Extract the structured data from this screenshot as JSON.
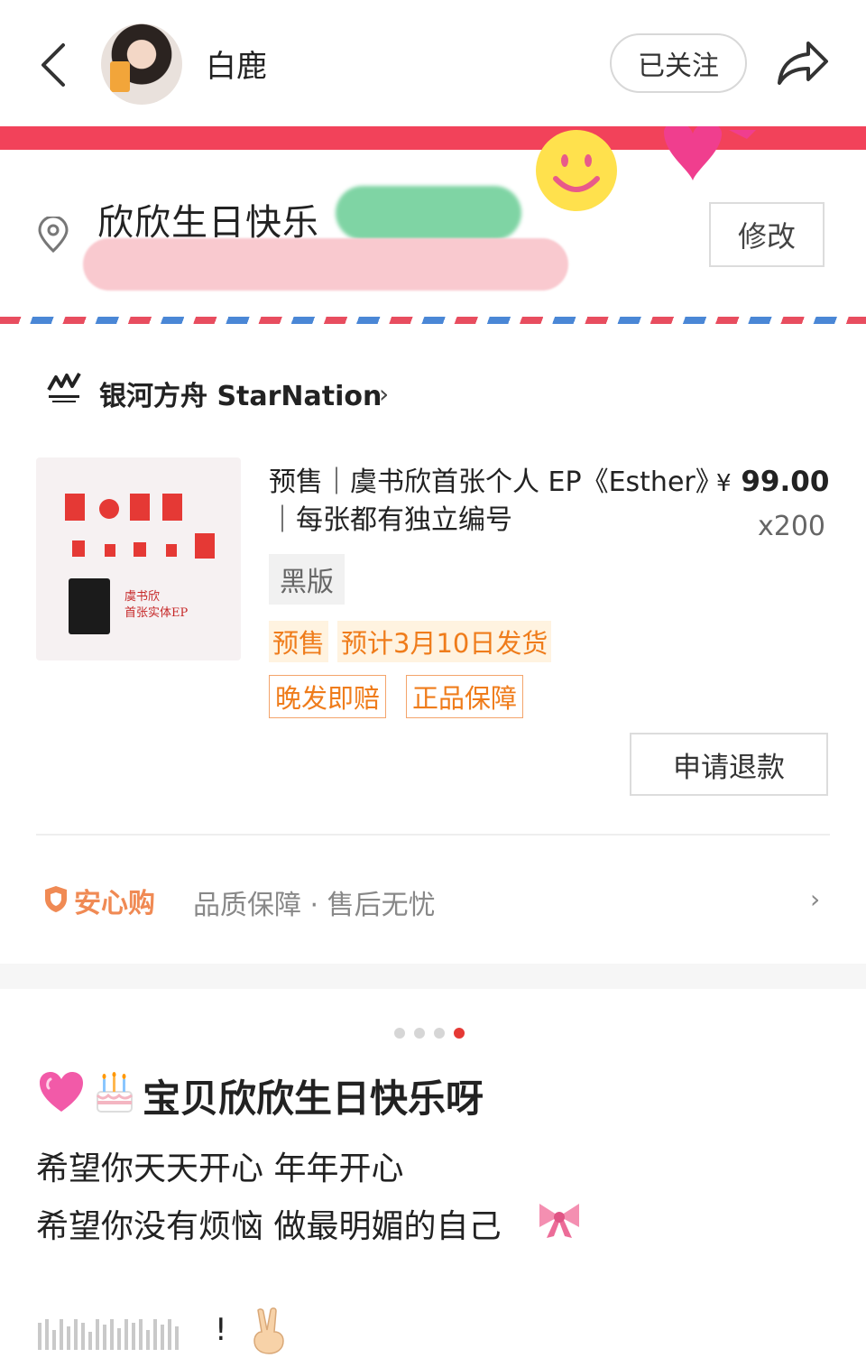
{
  "header": {
    "user_name": "白鹿",
    "follow_label": "已关注"
  },
  "address": {
    "title": "欣欣生日快乐",
    "edit_label": "修改"
  },
  "shop": {
    "name": "银河方舟 StarNation",
    "arrow": "›"
  },
  "product": {
    "title": "预售｜虞书欣首张个人 EP《Esther》｜每张都有独立编号",
    "price_symbol": "¥",
    "price_value": "99.00",
    "quantity": "x200",
    "variant": "黑版",
    "presale_tag": "预售",
    "ship_tag": "预计3月10日发货",
    "guarantee_tags": [
      "晚发即赔",
      "正品保障"
    ],
    "image_text_line1": "虞书欣",
    "image_text_line2": "首张实体EP",
    "refund_label": "申请退款"
  },
  "assurance": {
    "label": "安心购",
    "description": "品质保障 · 售后无忧",
    "arrow": "›"
  },
  "carousel": {
    "count": 4,
    "active_index": 3
  },
  "post": {
    "title": "宝贝欣欣生日快乐呀",
    "line1": "希望你天天开心 年年开心",
    "line2": "希望你没有烦恼 做最明媚的自己",
    "line3_end": "!"
  },
  "colors": {
    "accent_red": "#f2425a",
    "tag_orange": "#ef7c1b",
    "assurance_orange": "#f08a54"
  },
  "icons": [
    "back-icon",
    "share-icon",
    "location-pin-icon",
    "smiley-icon",
    "heart-icon",
    "shield-icon",
    "growing-heart-icon",
    "cake-icon",
    "ribbon-icon",
    "victory-hand-icon"
  ]
}
